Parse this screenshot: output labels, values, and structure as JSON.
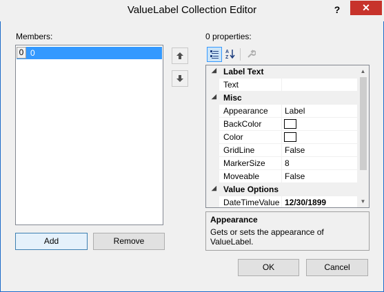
{
  "window": {
    "title": "ValueLabel Collection Editor",
    "help_label": "?",
    "close_label": "✕"
  },
  "members": {
    "label": "Members:",
    "items": [
      {
        "index": "0",
        "name": "0",
        "selected": true
      }
    ],
    "move_up_icon": "arrow-up-icon",
    "move_down_icon": "arrow-down-icon"
  },
  "buttons": {
    "add": "Add",
    "remove": "Remove",
    "ok": "OK",
    "cancel": "Cancel"
  },
  "properties": {
    "label": "0 properties:",
    "toolbar": {
      "categorized_icon": "categorized-icon",
      "alphabetical_icon": "alphabetical-icon",
      "property_pages_icon": "wrench-icon"
    },
    "categories": [
      {
        "name": "Label Text",
        "rows": [
          {
            "name": "Text",
            "value": ""
          }
        ]
      },
      {
        "name": "Misc",
        "rows": [
          {
            "name": "Appearance",
            "value": "Label"
          },
          {
            "name": "BackColor",
            "value": "",
            "swatch": "#ffffff"
          },
          {
            "name": "Color",
            "value": "",
            "swatch": "#ffffff"
          },
          {
            "name": "GridLine",
            "value": "False"
          },
          {
            "name": "MarkerSize",
            "value": "8"
          },
          {
            "name": "Moveable",
            "value": "False"
          }
        ]
      },
      {
        "name": "Value Options",
        "rows": [
          {
            "name": "DateTimeValue",
            "value": "12/30/1899"
          }
        ]
      }
    ]
  },
  "description": {
    "title": "Appearance",
    "text": "Gets or sets the appearance of ValueLabel."
  },
  "colors": {
    "selection": "#3399ff",
    "close_button": "#c7332b",
    "frame": "#1b6ac9"
  }
}
